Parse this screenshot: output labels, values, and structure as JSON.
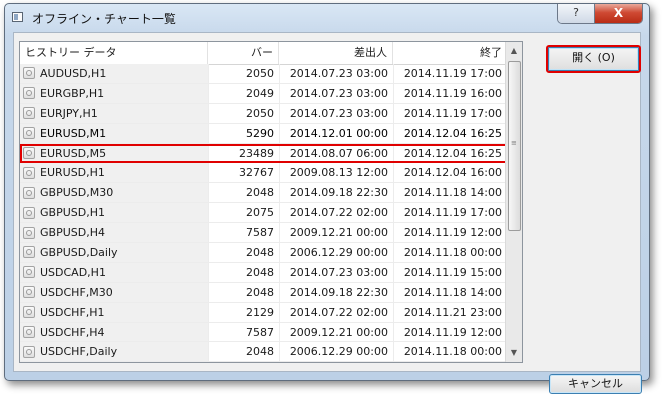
{
  "window": {
    "title": "オフライン・チャート一覧",
    "help_glyph": "?",
    "close_glyph": "X"
  },
  "table": {
    "headers": [
      "ヒストリー データ",
      "バー",
      "差出人",
      "終了"
    ],
    "rows": [
      {
        "symbol": "AUDUSD,H1",
        "bars": "2050",
        "from": "2014.07.23 03:00",
        "to": "2014.11.19 17:00"
      },
      {
        "symbol": "EURGBP,H1",
        "bars": "2049",
        "from": "2014.07.23 03:00",
        "to": "2014.11.19 16:00"
      },
      {
        "symbol": "EURJPY,H1",
        "bars": "2050",
        "from": "2014.07.23 03:00",
        "to": "2014.11.19 17:00"
      },
      {
        "symbol": "EURUSD,M1",
        "bars": "5290",
        "from": "2014.12.01 00:00",
        "to": "2014.12.04 16:25"
      },
      {
        "symbol": "EURUSD,M5",
        "bars": "23489",
        "from": "2014.08.07 06:00",
        "to": "2014.12.04 16:25"
      },
      {
        "symbol": "EURUSD,H1",
        "bars": "32767",
        "from": "2009.08.13 12:00",
        "to": "2014.12.04 16:00"
      },
      {
        "symbol": "GBPUSD,M30",
        "bars": "2048",
        "from": "2014.09.18 22:30",
        "to": "2014.11.18 14:00"
      },
      {
        "symbol": "GBPUSD,H1",
        "bars": "2075",
        "from": "2014.07.22 02:00",
        "to": "2014.11.19 17:00"
      },
      {
        "symbol": "GBPUSD,H4",
        "bars": "7587",
        "from": "2009.12.21 00:00",
        "to": "2014.11.19 12:00"
      },
      {
        "symbol": "GBPUSD,Daily",
        "bars": "2048",
        "from": "2006.12.29 00:00",
        "to": "2014.11.18 00:00"
      },
      {
        "symbol": "USDCAD,H1",
        "bars": "2048",
        "from": "2014.07.23 03:00",
        "to": "2014.11.19 15:00"
      },
      {
        "symbol": "USDCHF,M30",
        "bars": "2048",
        "from": "2014.09.18 22:30",
        "to": "2014.11.18 14:00"
      },
      {
        "symbol": "USDCHF,H1",
        "bars": "2129",
        "from": "2014.07.22 02:00",
        "to": "2014.11.21 23:00"
      },
      {
        "symbol": "USDCHF,H4",
        "bars": "7587",
        "from": "2009.12.21 00:00",
        "to": "2014.11.19 12:00"
      },
      {
        "symbol": "USDCHF,Daily",
        "bars": "2048",
        "from": "2006.12.29 00:00",
        "to": "2014.11.18 00:00"
      }
    ],
    "selected_index": 3
  },
  "buttons": {
    "open_label": "開く (O)",
    "cancel_label": "キャンセル"
  },
  "icons": {
    "row_icon": "chart-symbol-icon",
    "scroll_up": "▲",
    "scroll_down": "▼",
    "scroll_grip": "≡"
  },
  "colors": {
    "highlight_red": "#e00000",
    "titlebar": "#c7d8eb",
    "close_button": "#cf4a34"
  }
}
